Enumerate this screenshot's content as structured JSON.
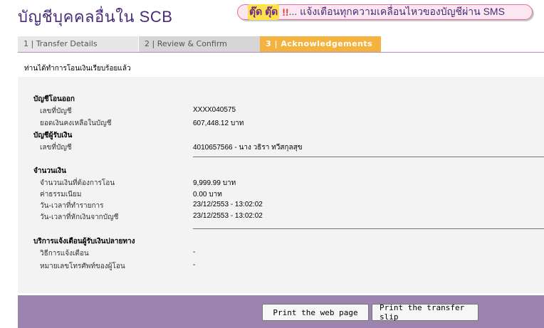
{
  "header": {
    "title": "บัญชีบุคคลอื่นใน SCB",
    "sms_alert": "ตุ๊ด ตุ๊ด",
    "sms_bang": "!!",
    "sms_text": "... แจ้งเตือนทุกความเคลื่อนไหวของบัญชีผ่าน SMS"
  },
  "tabs": [
    {
      "label": "1 | Transfer Details",
      "active": false
    },
    {
      "label": "2 | Review & Confirm",
      "active": false
    },
    {
      "label": "3 | Acknowledgements",
      "active": true
    }
  ],
  "confirmation_message": "ท่านได้ทำการโอนเงินเรียบร้อยแล้ว",
  "from_account": {
    "section_title": "บัญชีโอนออก",
    "account_no_label": "เลขที่บัญชี",
    "account_no_value": "XXXX040575",
    "balance_label": "ยอดเงินคงเหลือในบัญชี",
    "balance_value": "607,448.12 บาท"
  },
  "to_account": {
    "section_title": "บัญชีผู้รับเงิน",
    "account_no_label": "เลขที่บัญชี",
    "account_no_value": "4010657566 - นาง วธิรา ทวีสกุลสุข"
  },
  "amount": {
    "section_title": "จำนวนเงิน",
    "transfer_amount_label": "จำนวนเงินที่ต้องการโอน",
    "transfer_amount_value": "9,999.99 บาท",
    "fee_label": "ค่าธรรมเนียม",
    "fee_value": "0.00 บาท",
    "transaction_time_label": "วัน-เวลาที่ทำรายการ",
    "transaction_time_value": "23/12/2553 - 13:02:02",
    "debit_time_label": "วัน-เวลาที่หักเงินจากบัญชี",
    "debit_time_value": "23/12/2553 - 13:02:02"
  },
  "notification": {
    "section_title": "บริการแจ้งเตือนผู้รับเงินปลายทาง",
    "method_label": "วิธีการแจ้งเตือน",
    "method_value": "-",
    "phone_label": "หมายเลขโทรศัพท์ของผู้โอน",
    "phone_value": "-"
  },
  "buttons": {
    "print_web": "Print the web page",
    "print_slip": "Print the transfer slip"
  },
  "colors": {
    "title": "#4a2a7a",
    "active_tab": "#f4b33f",
    "footer": "#9b84b0",
    "banner_border": "#e46aa0"
  }
}
